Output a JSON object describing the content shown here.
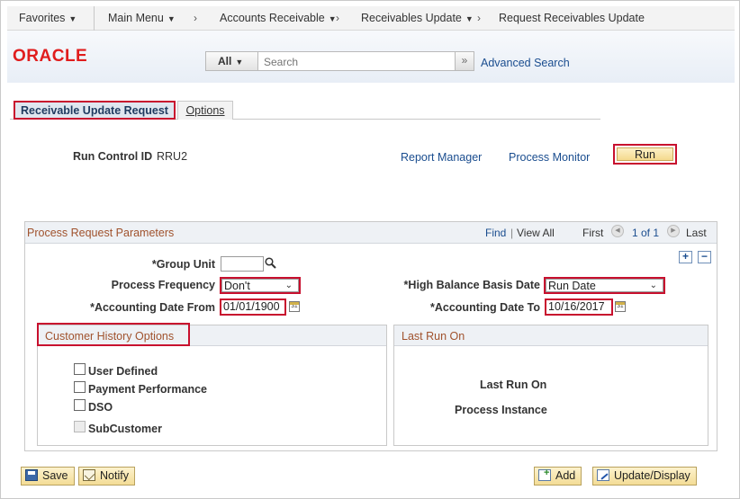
{
  "nav": {
    "favorites": "Favorites",
    "main_menu": "Main Menu",
    "accounts_receivable": "Accounts Receivable",
    "receivables_update": "Receivables Update",
    "request_receivables_update": "Request Receivables Update",
    "separator": "›"
  },
  "header": {
    "logo": "ORACLE",
    "search_scope": "All",
    "search_placeholder": "Search",
    "search_go": "»",
    "advanced_search": "Advanced Search"
  },
  "tabs": [
    {
      "label": "Receivable Update Request",
      "active": true
    },
    {
      "label": "Options",
      "active": false
    }
  ],
  "run_control": {
    "label": "Run Control ID",
    "value": "RRU2",
    "report_manager": "Report Manager",
    "process_monitor": "Process Monitor",
    "run_button": "Run"
  },
  "params": {
    "title": "Process Request Parameters",
    "find": "Find",
    "separator": "|",
    "view_all": "View All",
    "first": "First",
    "prev": "◀",
    "range": "1 of 1",
    "next": "▶",
    "last": "Last",
    "add_row": "+",
    "delete_row": "−",
    "group_unit_label": "*Group Unit",
    "group_unit_value": "",
    "process_frequency_label": "Process Frequency",
    "process_frequency_value": "Don't",
    "high_balance_label": "*High Balance Basis Date",
    "high_balance_value": "Run Date",
    "acct_date_from_label": "*Accounting Date From",
    "acct_date_from_value": "01/01/1900",
    "acct_date_to_label": "*Accounting Date To",
    "acct_date_to_value": "10/16/2017",
    "calendar_icon_text": "31"
  },
  "customer_history": {
    "title": "Customer History Options",
    "options": [
      {
        "label": "User Defined",
        "checked": false,
        "disabled": false
      },
      {
        "label": "Payment Performance",
        "checked": false,
        "disabled": false
      },
      {
        "label": "DSO",
        "checked": false,
        "disabled": false
      },
      {
        "label": "SubCustomer",
        "checked": false,
        "disabled": true
      }
    ]
  },
  "last_run": {
    "title": "Last Run On",
    "last_run_on_label": "Last Run On",
    "process_instance_label": "Process Instance"
  },
  "footer": {
    "save": "Save",
    "notify": "Notify",
    "add": "Add",
    "update_display": "Update/Display"
  },
  "colors": {
    "highlight_red": "#c8102e",
    "link_blue": "#1a4d8f",
    "section_title": "#a0522d",
    "oracle_red": "#e01d1d"
  }
}
